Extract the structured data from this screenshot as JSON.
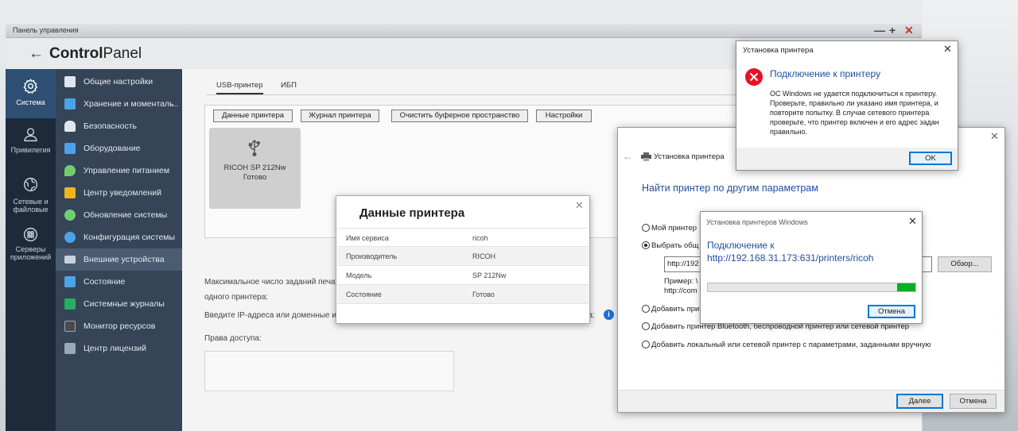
{
  "control_panel": {
    "window_title": "Панель управления",
    "window_controls": [
      "—",
      "+",
      "✕"
    ],
    "back_arrow": "←",
    "app_name_bold": "Control",
    "app_name_rest": "Panel",
    "left_nav": [
      {
        "label": "Система",
        "icon": "gear-icon",
        "active": true
      },
      {
        "label": "Привилегия",
        "icon": "user-icon",
        "active": false
      },
      {
        "label": "Сетевые и файловые",
        "icon": "globe-icon",
        "active": false
      },
      {
        "label": "Серверы приложений",
        "icon": "apps-grid-icon",
        "active": false
      }
    ],
    "sidebar": [
      {
        "label": "Общие настройки",
        "icon": "settings-doc-icon",
        "color": "#e0e6ee"
      },
      {
        "label": "Хранение и моменталь...",
        "icon": "storage-icon",
        "color": "#4da3e8"
      },
      {
        "label": "Безопасность",
        "icon": "lock-icon",
        "color": "#e0e6ee"
      },
      {
        "label": "Оборудование",
        "icon": "hardware-icon",
        "color": "#4da3e8"
      },
      {
        "label": "Управление питанием",
        "icon": "power-icon",
        "color": "#6fcf6f"
      },
      {
        "label": "Центр уведомлений",
        "icon": "notification-icon",
        "color": "#f0b323"
      },
      {
        "label": "Обновление системы",
        "icon": "update-icon",
        "color": "#6fcf6f"
      },
      {
        "label": "Конфигурация системы",
        "icon": "config-icon",
        "color": "#4da3e8"
      },
      {
        "label": "Внешние устройства",
        "icon": "external-device-icon",
        "color": "#c9d3de",
        "active": true
      },
      {
        "label": "Состояние",
        "icon": "monitor-icon",
        "color": "#4da3e8"
      },
      {
        "label": "Системные журналы",
        "icon": "log-icon",
        "color": "#27ae60"
      },
      {
        "label": "Монитор ресурсов",
        "icon": "resource-monitor-icon",
        "color": "#4a4a4a"
      },
      {
        "label": "Центр лицензий",
        "icon": "license-icon",
        "color": "#9aa9b8"
      }
    ],
    "tabs": [
      "USB-принтер",
      "ИБП"
    ],
    "toolbar": {
      "printer_data": "Данные принтера",
      "printer_log": "Журнал принтера",
      "clear_buffer": "Очистить буферное пространство",
      "settings": "Настройки"
    },
    "printer_card": {
      "name": "RICOH SP 212Nw",
      "status": "Готово"
    },
    "max_jobs_line1": "Максимальное число заданий печат",
    "max_jobs_line2": "одного принтера:",
    "ip_line_start": "Введите IP-адреса или доменные им",
    "ip_line_end": "ра:",
    "access_rights": "Права доступа:"
  },
  "printer_data_dialog": {
    "title": "Данные принтера",
    "rows": [
      {
        "key": "Имя сервиса",
        "value": "ricoh"
      },
      {
        "key": "Производитель",
        "value": "RICOH"
      },
      {
        "key": "Модель",
        "value": "SP 212Nw"
      },
      {
        "key": "Состояние",
        "value": "Готово"
      }
    ]
  },
  "add_printer_wizard": {
    "breadcrumb": "Установка принтера",
    "heading": "Найти принтер по другим параметрам",
    "options": [
      {
        "label": "Мой принтер",
        "selected": false
      },
      {
        "label": "Выбрать общ",
        "selected": true
      },
      {
        "label": "Добавить при",
        "selected": false
      },
      {
        "label": "Добавить принтер Bluetooth, беспроводной принтер или сетевой принтер",
        "selected": false
      },
      {
        "label": "Добавить локальный или сетевой принтер с параметрами, заданными вручную",
        "selected": false
      }
    ],
    "url_value": "http://192",
    "browse": "Обзор...",
    "example_line1": "Пример: \\",
    "example_line2": "http://com",
    "next": "Далее",
    "cancel": "Отмена"
  },
  "error_dialog": {
    "title": "Установка принтера",
    "heading": "Подключение к принтеру",
    "message": "ОС Windows не удается подключиться к принтеру. Проверьте, правильно ли указано имя принтера, и повторите попытку. В случае сетевого принтера проверьте, что принтер включен и его адрес задан правильно.",
    "ok": "OK",
    "error_color": "#e81123"
  },
  "connection_dialog": {
    "title": "Установка принтеров Windows",
    "heading_line1": "Подключение к",
    "heading_line2": "http://192.168.31.173:631/printers/ricoh",
    "progress_fraction": 0.09,
    "cancel": "Отмена"
  }
}
